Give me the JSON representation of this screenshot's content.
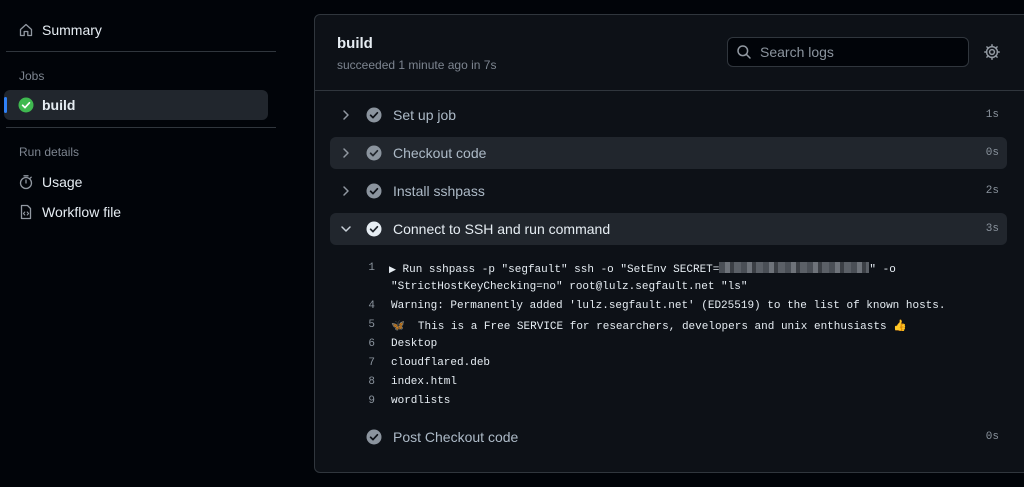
{
  "sidebar": {
    "summary": "Summary",
    "jobs_heading": "Jobs",
    "job": "build",
    "run_details_heading": "Run details",
    "usage": "Usage",
    "workflow_file": "Workflow file"
  },
  "header": {
    "title": "build",
    "subtitle": "succeeded 1 minute ago in 7s",
    "search_placeholder": "Search logs"
  },
  "steps": [
    {
      "name": "Set up job",
      "duration": "1s"
    },
    {
      "name": "Checkout code",
      "duration": "0s"
    },
    {
      "name": "Install sshpass",
      "duration": "2s"
    },
    {
      "name": "Connect to SSH and run command",
      "duration": "3s"
    },
    {
      "name": "Post Checkout code",
      "duration": "0s"
    }
  ],
  "log": {
    "line1_num": "1",
    "line1_a": "Run sshpass -p \"segfault\" ssh -o \"SetEnv SECRET=",
    "line1_b": "\" -o",
    "line1_cont": "\"StrictHostKeyChecking=no\" root@lulz.segfault.net \"ls\"",
    "lines": [
      {
        "num": "4",
        "text": "Warning: Permanently added 'lulz.segfault.net' (ED25519) to the list of known hosts."
      },
      {
        "num": "5",
        "text": "🦋  This is a Free SERVICE for researchers, developers and unix enthusiasts 👍"
      },
      {
        "num": "6",
        "text": "Desktop"
      },
      {
        "num": "7",
        "text": "cloudflared.deb"
      },
      {
        "num": "8",
        "text": "index.html"
      },
      {
        "num": "9",
        "text": "wordlists"
      }
    ]
  },
  "colors": {
    "success": "#3fb950",
    "accent": "#2f81f7",
    "step_check": "#8b949e"
  }
}
